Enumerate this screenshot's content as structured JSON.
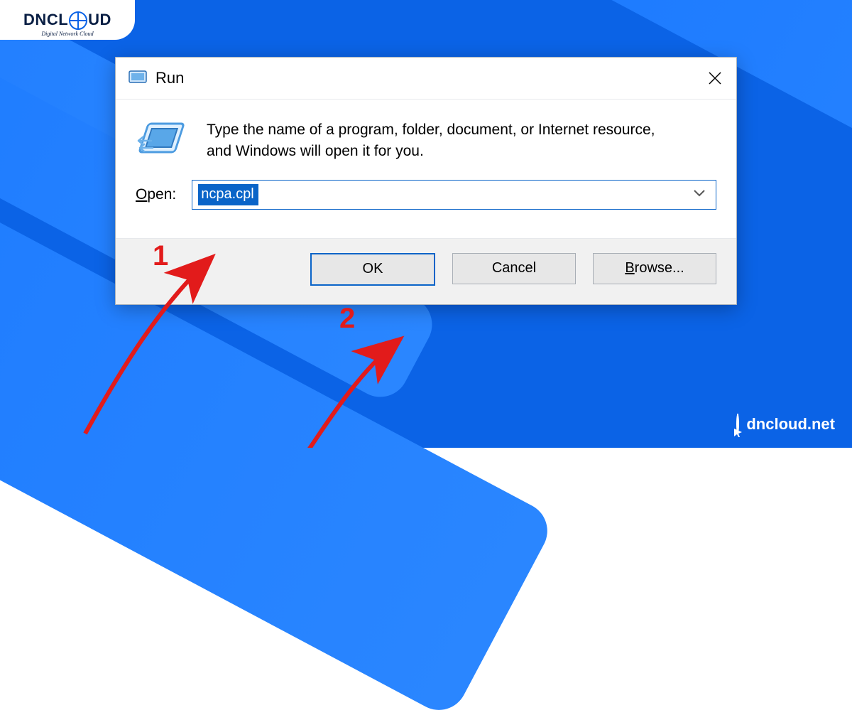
{
  "brand": {
    "name_left": "DNCL",
    "name_right": "UD",
    "tagline": "Digital Network Cloud"
  },
  "dialog": {
    "title": "Run",
    "description": "Type the name of a program, folder, document, or Internet resource, and Windows will open it for you.",
    "open_label_pre": "O",
    "open_label_post": "pen:",
    "input_value": "ncpa.cpl",
    "buttons": {
      "ok": "OK",
      "cancel": "Cancel",
      "browse_pre": "B",
      "browse_post": "rowse..."
    }
  },
  "annotations": {
    "step1": "1",
    "step2": "2"
  },
  "site": {
    "url": "dncloud.net"
  }
}
